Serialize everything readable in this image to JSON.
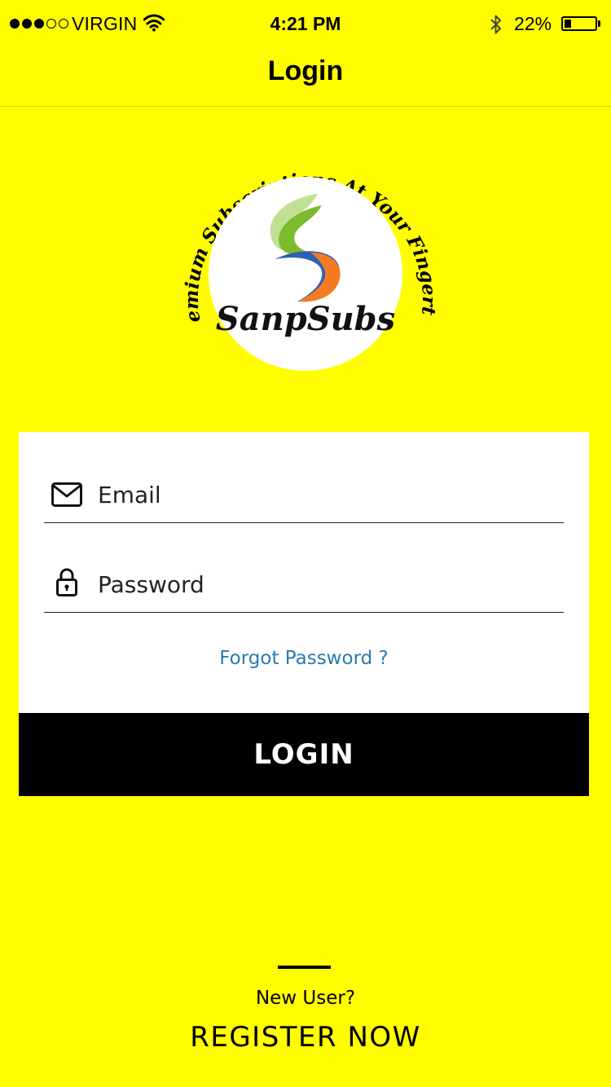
{
  "status_bar": {
    "signal_dots_filled": 3,
    "signal_dots_total": 5,
    "carrier": "VIRGIN",
    "time": "4:21 PM",
    "battery_percent": "22%",
    "battery_level": 0.22,
    "icons": [
      "wifi-icon",
      "bluetooth-icon",
      "battery-icon"
    ]
  },
  "nav": {
    "title": "Login"
  },
  "logo": {
    "brand": "SanpSubs",
    "tagline": "Premium Subscriptions At Your Fingertips",
    "colors": [
      "#8cc63f",
      "#2d5fb6",
      "#f47b20"
    ]
  },
  "form": {
    "email": {
      "placeholder": "Email",
      "value": "",
      "icon": "envelope-icon"
    },
    "password": {
      "placeholder": "Password",
      "value": "",
      "icon": "lock-icon"
    },
    "forgot_label": "Forgot Password ?",
    "submit_label": "LOGIN"
  },
  "footer": {
    "new_user_label": "New User?",
    "register_label": "REGISTER NOW"
  },
  "colors": {
    "background": "#fffd00",
    "button": "#000000",
    "link": "#2a7ab0"
  }
}
